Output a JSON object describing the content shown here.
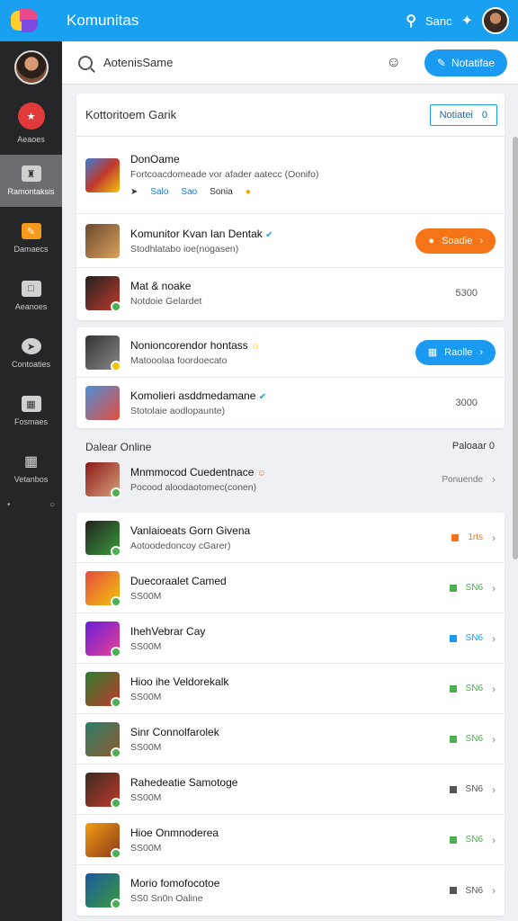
{
  "header": {
    "app_title": "Komunitas",
    "search_label": "Sanc"
  },
  "search": {
    "value": "AotenisSame"
  },
  "toolbar": {
    "notify_label": "Notatifae"
  },
  "sidebar": {
    "items": [
      {
        "label": "Aeaoes",
        "icon": "shield-icon"
      },
      {
        "label": "Ramontaksis",
        "icon": "people-icon"
      },
      {
        "label": "Damaecs",
        "icon": "gamepad-icon"
      },
      {
        "label": "Aeanoes",
        "icon": "chat-icon"
      },
      {
        "label": "Contoaties",
        "icon": "compass-icon"
      },
      {
        "label": "Fosmaes",
        "icon": "calendar-icon"
      },
      {
        "label": "Vetanbos",
        "icon": "grid-icon"
      }
    ]
  },
  "card1": {
    "title": "Kottoritoem Garik",
    "button": "Notiatei",
    "button_count": "0",
    "featured": {
      "title": "DonOame",
      "subtitle": "Fortcoacdomeade vor afader aatecc (Oonifo)",
      "meta1": "Salo",
      "meta2": "Sao",
      "meta3": "Sonia"
    },
    "rows": [
      {
        "title": "Komunitor Kvan Ian Dentak",
        "subtitle": "Stodhlatabo ioe(nogasen)",
        "action": "Soadie",
        "verified": true
      },
      {
        "title": "Mat & noake",
        "subtitle": "Notdoie Gelardet",
        "count": "5300"
      }
    ]
  },
  "card2": {
    "rows": [
      {
        "title": "Nonioncorendor hontass",
        "subtitle": "Matooolaa foordoecato",
        "action": "Raolle"
      },
      {
        "title": "Komolieri asddmedamane",
        "subtitle": "Stotolaie aodlopaunte)",
        "count": "3000"
      }
    ]
  },
  "section": {
    "label": "Dalear Online",
    "right": "Paloaar",
    "right_count": "0"
  },
  "online": {
    "title": "Mnmmocod Cuedentnace",
    "subtitle": "Pocood aloodaotomec(conen)",
    "action": "Ponuende"
  },
  "list": [
    {
      "title": "Vanlaioeats Gorn Givena",
      "subtitle": "Aotoodedoncoy cGarer)",
      "status": "1rts",
      "color": "#f57418"
    },
    {
      "title": "Duecoraalet Camed",
      "subtitle": "SS00M",
      "status": "SN6",
      "color": "#4caf50"
    },
    {
      "title": "IhehVebrar Cay",
      "subtitle": "SS00M",
      "status": "SN6",
      "color": "#1a9af0"
    },
    {
      "title": "Hioo ihe Veldorekalk",
      "subtitle": "SS00M",
      "status": "SN6",
      "color": "#4caf50"
    },
    {
      "title": "Sinr Connolfarolek",
      "subtitle": "SS00M",
      "status": "SN6",
      "color": "#4caf50"
    },
    {
      "title": "Rahedeatie Samotoge",
      "subtitle": "SS00M",
      "status": "SN6",
      "color": "#555555"
    },
    {
      "title": "Hioe Onmnoderea",
      "subtitle": "SS00M",
      "status": "SN6",
      "color": "#4caf50"
    },
    {
      "title": "Morio fomofocotoe",
      "subtitle": "SS0 Sn0n Oaline",
      "status": "SN6",
      "color": "#555555"
    }
  ]
}
